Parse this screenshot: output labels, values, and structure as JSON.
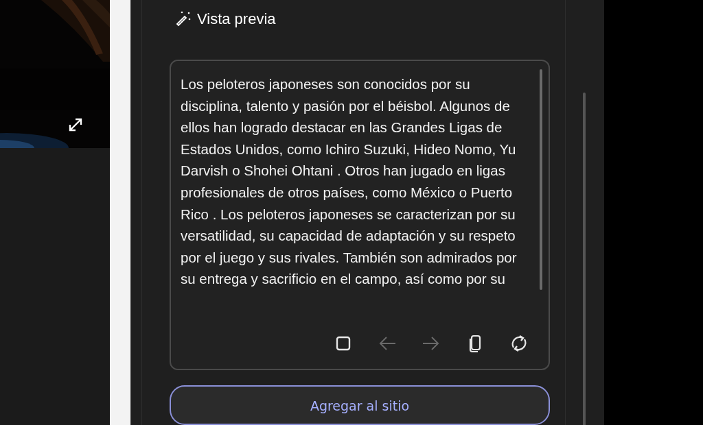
{
  "preview": {
    "title": "Vista previa",
    "text": "Los peloteros japoneses son conocidos por su disciplina, talento y pasión por el béisbol. Algunos de ellos han logrado destacar en las Grandes Ligas de Estados Unidos, como Ichiro Suzuki, Hideo Nomo, Yu Darvish o Shohei Ohtani . Otros han jugado en ligas profesionales de otros países, como México o Puerto Rico . Los peloteros japoneses se caracterizan por su versatilidad, su capacidad de adaptación y su respeto por el juego y sus rivales. También son admirados por su entrega y sacrificio en el campo, así como por su",
    "tools": [
      {
        "kind": "stop",
        "disabled": false
      },
      {
        "kind": "back",
        "disabled": true
      },
      {
        "kind": "forward",
        "disabled": true
      },
      {
        "kind": "copy",
        "disabled": false
      },
      {
        "kind": "regenerate",
        "disabled": false
      }
    ]
  },
  "action_button": {
    "label": "Agregar al sitio"
  }
}
